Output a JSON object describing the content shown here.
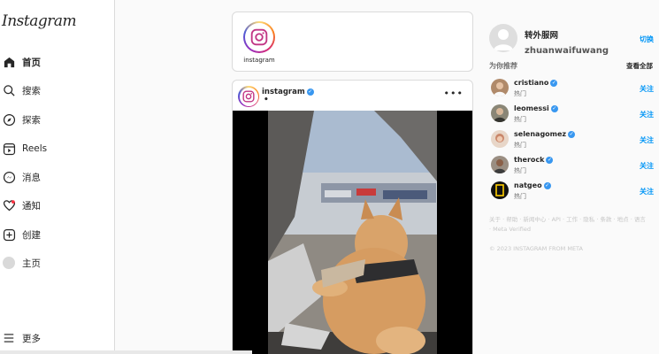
{
  "app": {
    "logo_text": "Instagram"
  },
  "sidebar": {
    "items": [
      {
        "label": "首页",
        "icon": "home-icon"
      },
      {
        "label": "搜索",
        "icon": "search-icon"
      },
      {
        "label": "探索",
        "icon": "compass-icon"
      },
      {
        "label": "Reels",
        "icon": "reels-icon"
      },
      {
        "label": "消息",
        "icon": "messenger-icon"
      },
      {
        "label": "通知",
        "icon": "heart-icon"
      },
      {
        "label": "创建",
        "icon": "plus-square-icon"
      },
      {
        "label": "主页",
        "icon": "profile-avatar"
      }
    ],
    "more_label": "更多"
  },
  "stories": {
    "items": [
      {
        "name": "instagram"
      }
    ]
  },
  "post": {
    "username": "instagram",
    "caption_dot": "•",
    "more": "•••"
  },
  "right": {
    "me_name": "转外服网",
    "me_sub": "zhuanwaifuwang",
    "switch_label": "切换",
    "suggestions_title": "为你推荐",
    "see_all_label": "查看全部",
    "suggestions": [
      {
        "name": "cristiano",
        "sub": "热门",
        "follow": "关注"
      },
      {
        "name": "leomessi",
        "sub": "热门",
        "follow": "关注"
      },
      {
        "name": "selenagomez",
        "sub": "热门",
        "follow": "关注"
      },
      {
        "name": "therock",
        "sub": "热门",
        "follow": "关注"
      },
      {
        "name": "natgeo",
        "sub": "热门",
        "follow": "关注"
      }
    ],
    "footer_links": "关于 · 帮助 · 新闻中心 · API · 工作 · 隐私 · 条款 · 地点 · 语言 · Meta Verified",
    "copyright": "© 2023 INSTAGRAM FROM META"
  },
  "colors": {
    "accent": "#0095f6",
    "verified": "#3897f0",
    "border": "#dbdbdb",
    "background": "#fafafa"
  }
}
